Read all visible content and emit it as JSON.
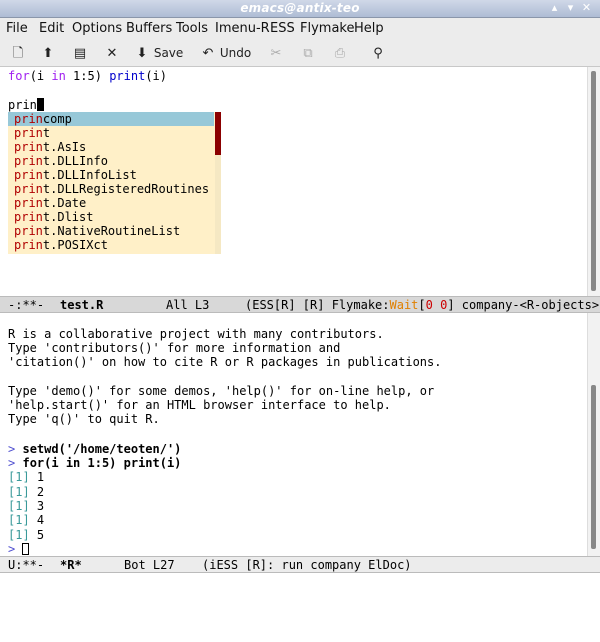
{
  "window": {
    "title": "emacs@antix-teo",
    "btn_min": "▴",
    "btn_max": "▾",
    "btn_close": "✕"
  },
  "menu": [
    "File",
    "Edit",
    "Options",
    "Buffers",
    "Tools",
    "Imenu-R",
    "ESS",
    "Flymake",
    "Help"
  ],
  "toolbar": {
    "save_label": "Save",
    "undo_label": "Undo"
  },
  "editor": {
    "line1_kw1": "for",
    "line1_a": "(i ",
    "line1_kw2": "in",
    "line1_b": " 1:5) ",
    "line1_fn": "print",
    "line1_c": "(i)",
    "typed": "prin"
  },
  "completions": [
    {
      "match": "prin",
      "rest": "comp"
    },
    {
      "match": "prin",
      "rest": "t"
    },
    {
      "match": "prin",
      "rest": "t.AsIs"
    },
    {
      "match": "prin",
      "rest": "t.DLLInfo"
    },
    {
      "match": "prin",
      "rest": "t.DLLInfoList"
    },
    {
      "match": "prin",
      "rest": "t.DLLRegisteredRoutines"
    },
    {
      "match": "prin",
      "rest": "t.Date"
    },
    {
      "match": "prin",
      "rest": "t.Dlist"
    },
    {
      "match": "prin",
      "rest": "t.NativeRoutineList"
    },
    {
      "match": "prin",
      "rest": "t.POSIXct"
    }
  ],
  "modeline1": {
    "status": "-:**-",
    "buffer": "test.R",
    "pos": "All L3",
    "modes_a": "(ESS[R] [R] Flymake:",
    "wait": "Wait",
    "bracket_open": "[",
    "err0": "0",
    "err1": "0",
    "bracket_close": "]",
    "modes_b": " company-<R-objects>"
  },
  "repl": {
    "banner": [
      "R is a collaborative project with many contributors.",
      "Type 'contributors()' for more information and",
      "'citation()' on how to cite R or R packages in publications.",
      "",
      "Type 'demo()' for some demos, 'help()' for on-line help, or",
      "'help.start()' for an HTML browser interface to help.",
      "Type 'q()' to quit R."
    ],
    "prompt": ">",
    "cmd1": "setwd('/home/teoten/')",
    "cmd2": "for(i in 1:5) print(i)",
    "outputs": [
      {
        "idx": "[1]",
        "val": "1"
      },
      {
        "idx": "[1]",
        "val": "2"
      },
      {
        "idx": "[1]",
        "val": "3"
      },
      {
        "idx": "[1]",
        "val": "4"
      },
      {
        "idx": "[1]",
        "val": "5"
      }
    ]
  },
  "modeline2": {
    "status": "U:**-",
    "buffer": "*R*",
    "pos": "Bot L27",
    "modes": "(iESS [R]: run company ElDoc)"
  },
  "colors": {
    "accent_selection": "#97c8d8",
    "popup_bg": "#fff0c8",
    "keyword": "#a020f0",
    "builtin": "#0000cc",
    "output": "#3a9a9a"
  }
}
